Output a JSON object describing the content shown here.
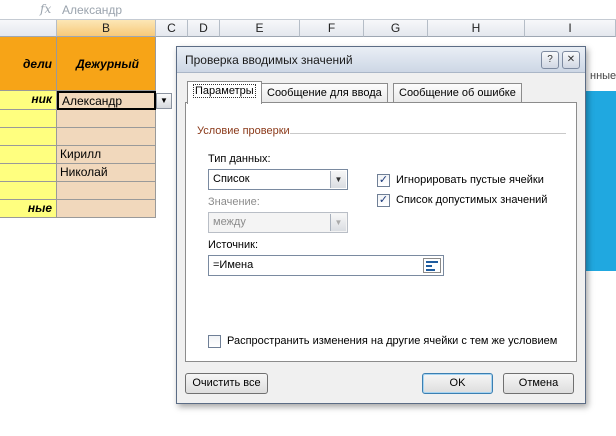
{
  "excel": {
    "formula_text": "Александр",
    "fx_symbol": "fx",
    "columns": [
      "B",
      "C",
      "D",
      "E",
      "F",
      "G",
      "H",
      "I"
    ],
    "header_left": "дели",
    "header_main": "Дежурный",
    "row_labels": [
      "ник",
      "",
      "",
      "",
      "",
      "ные"
    ],
    "duty_values": [
      "Александр",
      "",
      "",
      "Кирилл",
      "Николай",
      "",
      ""
    ],
    "edge_text": "нные"
  },
  "dialog": {
    "title": "Проверка вводимых значений",
    "help_icon": "question-icon",
    "close_icon": "close-icon",
    "tabs": [
      "Параметры",
      "Сообщение для ввода",
      "Сообщение об ошибке"
    ],
    "group_title": "Условие проверки",
    "data_type_label": "Тип данных:",
    "data_type_value": "Список",
    "value_label": "Значение:",
    "value_value": "между",
    "source_label": "Источник:",
    "source_value": "=Имена",
    "ignore_blank_label": "Игнорировать пустые ячейки",
    "ignore_blank_checked": true,
    "in_cell_dropdown_label": "Список допустимых значений",
    "in_cell_dropdown_checked": true,
    "apply_all_label": "Распространить изменения на другие ячейки с тем же условием",
    "apply_all_checked": false,
    "clear_all_button": "Очистить все",
    "ok_button": "OK",
    "cancel_button": "Отмена"
  }
}
